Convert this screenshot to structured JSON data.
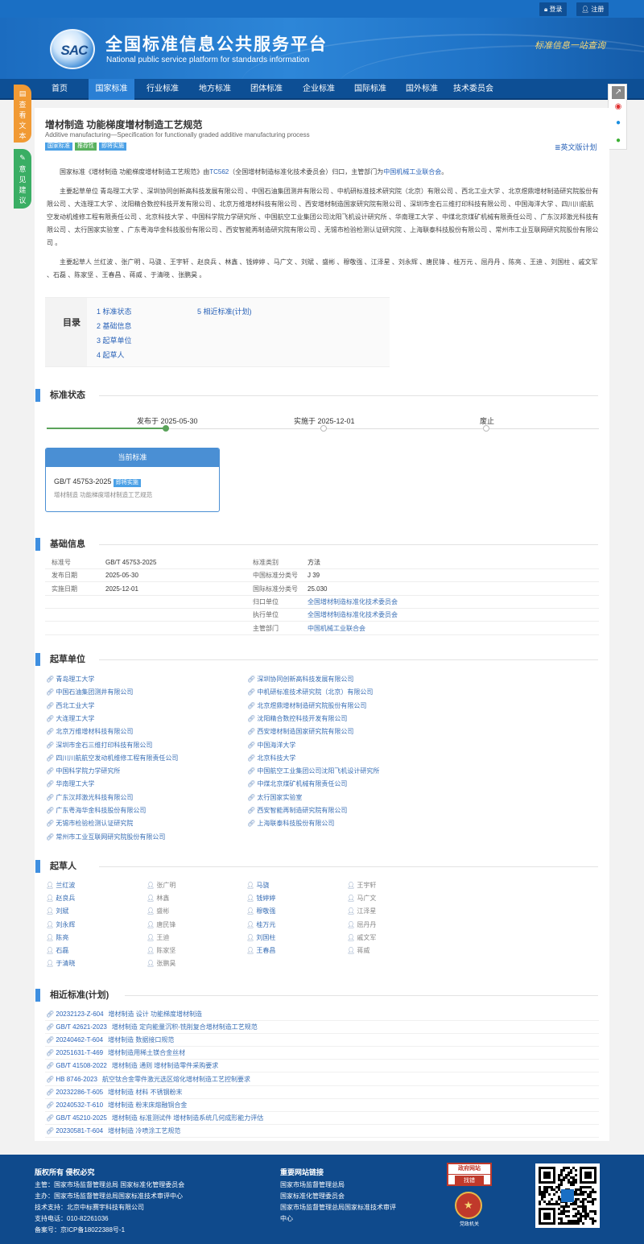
{
  "topbar": {
    "login": "登录",
    "register": "注册"
  },
  "header": {
    "logo": "SAC",
    "title": "全国标准信息公共服务平台",
    "subtitle": "National public service platform  for standards information",
    "slogan": "标准信息一站查询"
  },
  "nav": [
    "首页",
    "国家标准",
    "行业标准",
    "地方标准",
    "团体标准",
    "企业标准",
    "国际标准",
    "国外标准",
    "技术委员会"
  ],
  "sidetabs": {
    "view": "查看文本",
    "feedback": "意见建议"
  },
  "standard": {
    "title_cn": "增材制造 功能梯度增材制造工艺规范",
    "title_en": "Additive manufacturing—Specification for functionally graded additive manufacturing process",
    "tags": [
      "国家标准",
      "推荐性",
      "即将实施"
    ],
    "english_plan": "英文版计划",
    "intro1_a": "国家标准《增材制造 功能梯度增材制造工艺规范》由",
    "intro1_tc": "TC562",
    "intro1_b": "（全国增材制造标准化技术委员会）归口，主管部门为",
    "intro1_dept": "中国机械工业联合会",
    "intro1_c": "。",
    "intro2": "主要起草单位 青岛理工大学 、深圳协同创新高科技发展有限公司 、中国石油集团测井有限公司 、中机研标准技术研究院（北京）有限公司 、西北工业大学 、北京煜鼎增材制造研究院股份有限公司 、大连理工大学 、沈阳精合数控科技开发有限公司 、北京万维增材科技有限公司 、西安增材制造国家研究院有限公司 、深圳市金石三维打印科技有限公司 、中国海洋大学 、四川川航航空发动机维修工程有限责任公司 、北京科技大学 、中国科学院力学研究所 、中国航空工业集团公司沈阳飞机设计研究所 、华南理工大学 、中煤北京煤矿机械有限责任公司 、广东汉邦激光科技有限公司 、太行国家实验室 、广东粤海华金科技股份有限公司 、西安智能再制造研究院有限公司 、无锡市检验检测认证研究院 、上海联泰科技股份有限公司 、常州市工业互联网研究院股份有限公司 。",
    "intro3": "主要起草人 兰红波 、张广明 、马骁 、王宇轩 、赵良兵 、林鑫 、钱婷婷 、马广文 、刘斌 、盛彬 、穆敬强 、江泽星 、刘永辉 、唐民锋 、桂万元 、屈丹丹 、陈亮 、王迪 、刘国柱 、戚文军 、石磊 、陈家坚 、王春昌 、蒋威 、于清晓 、张鹏昊 。"
  },
  "toc": {
    "label": "目录",
    "items": [
      "1 标准状态",
      "2 基础信息",
      "3 起草单位",
      "4 起草人",
      "5 相近标准(计划)"
    ]
  },
  "status": {
    "heading": "标准状态",
    "steps": [
      "发布于 2025-05-30",
      "实施于 2025-12-01",
      "废止"
    ],
    "current_label": "当前标准",
    "current_code": "GB/T 45753-2025",
    "current_tag": "即将实施",
    "current_title": "增材制造 功能梯度增材制造工艺规范"
  },
  "basic": {
    "heading": "基础信息",
    "left": [
      [
        "标准号",
        "GB/T 45753-2025"
      ],
      [
        "发布日期",
        "2025-05-30"
      ],
      [
        "实施日期",
        "2025-12-01"
      ]
    ],
    "right": [
      [
        "标准类别",
        "方法"
      ],
      [
        "中国标准分类号",
        "J 39"
      ],
      [
        "国际标准分类号",
        "25.030"
      ],
      [
        "归口单位",
        "全国增材制造标准化技术委员会"
      ],
      [
        "执行单位",
        "全国增材制造标准化技术委员会"
      ],
      [
        "主管部门",
        "中国机械工业联合会"
      ]
    ]
  },
  "drafting_units": {
    "heading": "起草单位",
    "items": [
      "青岛理工大学",
      "深圳协同创新高科技发展有限公司",
      "中国石油集团测井有限公司",
      "中机研标准技术研究院（北京）有限公司",
      "西北工业大学",
      "北京煜鼎增材制造研究院股份有限公司",
      "大连理工大学",
      "沈阳精合数控科技开发有限公司",
      "北京万维增材科技有限公司",
      "西安增材制造国家研究院有限公司",
      "深圳市金石三维打印科技有限公司",
      "中国海洋大学",
      "四川川航航空发动机维修工程有限责任公司",
      "北京科技大学",
      "中国科学院力学研究所",
      "中国航空工业集团公司沈阳飞机设计研究所",
      "华南理工大学",
      "中煤北京煤矿机械有限责任公司",
      "广东汉邦激光科技有限公司",
      "太行国家实验室",
      "广东粤海华金科技股份有限公司",
      "西安智能再制造研究院有限公司",
      "无锡市检验检测认证研究院",
      "上海联泰科技股份有限公司",
      "常州市工业互联网研究院股份有限公司"
    ]
  },
  "drafters": {
    "heading": "起草人",
    "items": [
      "兰红波",
      "张广明",
      "马骁",
      "王宇轩",
      "赵良兵",
      "林鑫",
      "钱婷婷",
      "马广文",
      "刘斌",
      "盛彬",
      "穆敬强",
      "江泽星",
      "刘永辉",
      "唐民锋",
      "桂万元",
      "屈丹丹",
      "陈亮",
      "王迪",
      "刘国柱",
      "戚文军",
      "石磊",
      "陈家坚",
      "王春昌",
      "蒋威",
      "于清晓",
      "张鹏昊"
    ]
  },
  "related": {
    "heading": "相近标准(计划)",
    "items": [
      [
        "20232123-Z-604",
        "增材制造 设计 功能梯度增材制造"
      ],
      [
        "GB/T 42621-2023",
        "增材制造 定向能量沉积-铣削复合增材制造工艺规范"
      ],
      [
        "20240462-T-604",
        "增材制造 数据接口规范"
      ],
      [
        "20251631-T-469",
        "增材制造用稀土镁合金丝材"
      ],
      [
        "GB/T 41508-2022",
        "增材制造 通则 增材制造零件采购要求"
      ],
      [
        "HB 8746-2023",
        "航空钛合金零件激光选区熔化增材制造工艺控制要求"
      ],
      [
        "20232286-T-605",
        "增材制造 材料 不锈钢粉末"
      ],
      [
        "20240532-T-610",
        "增材制造 粉末床熔融铜合金"
      ],
      [
        "GB/T 45210-2025",
        "增材制造 标准测试件 增材制造系统几何成形能力评估"
      ],
      [
        "20230581-T-604",
        "增材制造 冷喷涂工艺规范"
      ]
    ]
  },
  "footer": {
    "copyright": "版权所有 侵权必究",
    "lines": [
      "主管：国家市场监督管理总局 国家标准化管理委员会",
      "主办：国家市场监督管理总局国家标准技术审评中心",
      "技术支持：北京中标赛宇科技有限公司",
      "支持电话：010-82261036",
      "备案号：京ICP备18022388号-1"
    ],
    "links_title": "重要网站链接",
    "links": [
      "国家市场监督管理总局",
      "国家标准化管理委员会",
      "国家市场监督管理总局国家标准技术审评",
      "中心"
    ],
    "badge1_top": "政府网站",
    "badge1_bottom": "找错",
    "badge2": "党政机关"
  }
}
